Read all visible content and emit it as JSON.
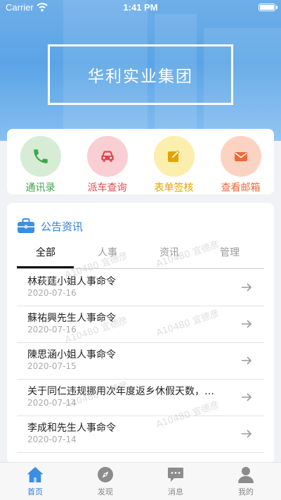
{
  "status_bar": {
    "carrier": "Carrier",
    "time": "1:41 PM"
  },
  "header": {
    "company_name": "华利实业集团"
  },
  "quick_actions": [
    {
      "label": "通讯录",
      "icon": "phone-icon",
      "color": "#3fa64d",
      "bg": "#d7ecd5"
    },
    {
      "label": "派车查询",
      "icon": "car-icon",
      "color": "#e2474b",
      "bg": "#f9cfd3"
    },
    {
      "label": "表单签核",
      "icon": "form-sign-icon",
      "color": "#e5a300",
      "bg": "#fcefae"
    },
    {
      "label": "查看邮箱",
      "icon": "mail-icon",
      "color": "#ee6a35",
      "bg": "#fcd3c2"
    }
  ],
  "news": {
    "title": "公告资讯",
    "tabs": [
      "全部",
      "人事",
      "资讯",
      "管理"
    ],
    "active_tab": "全部",
    "items": [
      {
        "title": "林萩莛小姐人事命令",
        "date": "2020-07-16"
      },
      {
        "title": "蘇祐興先生人事命令",
        "date": "2020-07-16"
      },
      {
        "title": "陳思涵小姐人事命令",
        "date": "2020-07-15"
      },
      {
        "title": "关于同仁违规挪用次年度返乡休假天数，…",
        "date": "2020-07-14"
      },
      {
        "title": "李成和先生人事命令",
        "date": "2020-07-14"
      }
    ],
    "watermark": "A10480 宜德彦"
  },
  "tabbar": [
    {
      "label": "首页",
      "icon": "home-icon"
    },
    {
      "label": "发现",
      "icon": "compass-icon"
    },
    {
      "label": "消息",
      "icon": "message-icon"
    },
    {
      "label": "我的",
      "icon": "user-icon"
    }
  ],
  "colors": {
    "accent": "#2b7ed6",
    "header_blue": "#5aa4e6"
  }
}
